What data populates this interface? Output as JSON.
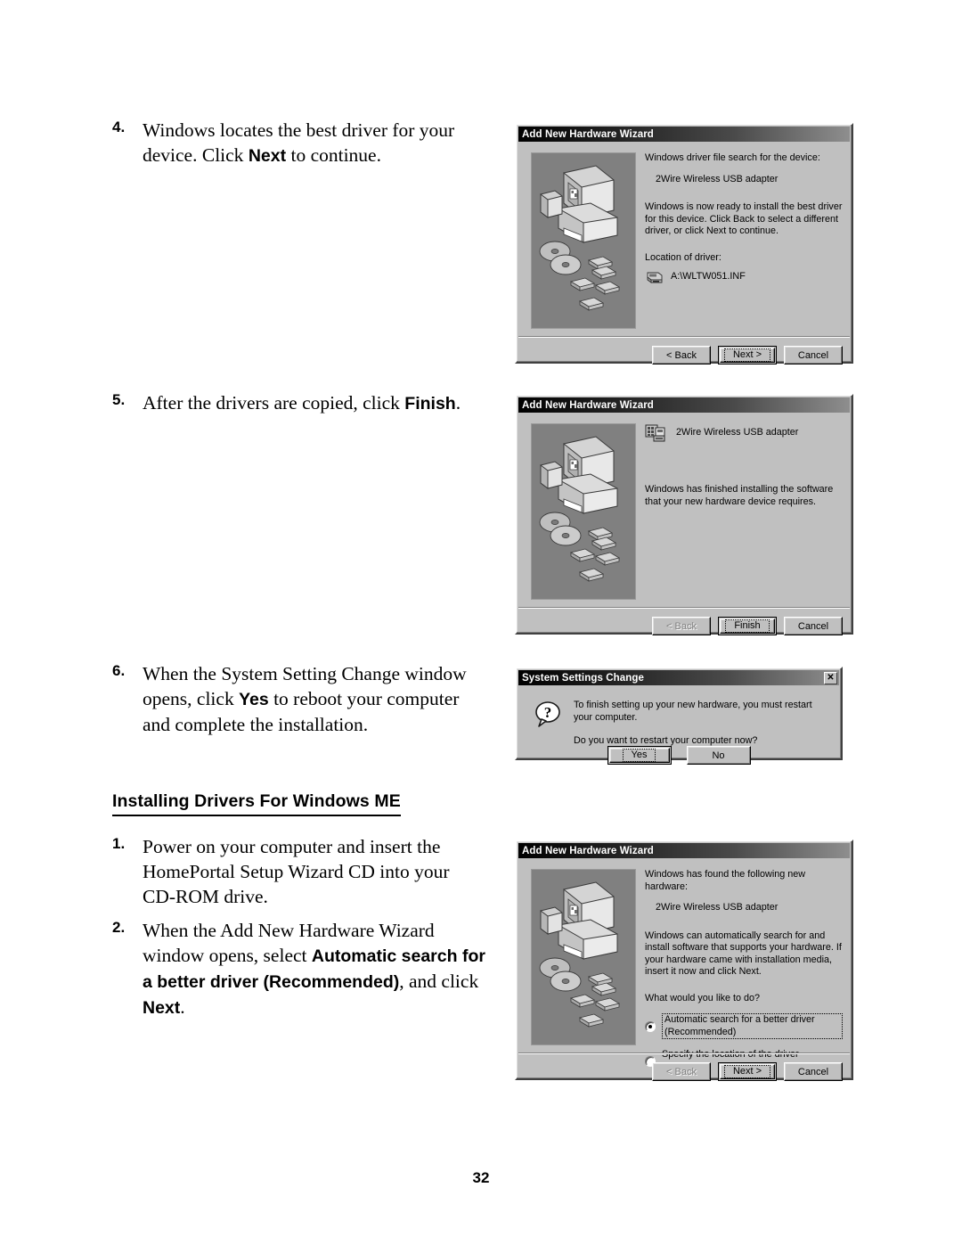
{
  "page": {
    "number": "32",
    "section_heading": "Installing Drivers For Windows ME"
  },
  "steps": [
    {
      "number": "4.",
      "text_parts": [
        {
          "t": "Windows locates the best driver for your device. Click ",
          "bold": false
        },
        {
          "t": "Next",
          "bold": true
        },
        {
          "t": " to continue.",
          "bold": false
        }
      ]
    },
    {
      "number": "5.",
      "text_parts": [
        {
          "t": "After the drivers are copied, click ",
          "bold": false
        },
        {
          "t": "Finish",
          "bold": true
        },
        {
          "t": ".",
          "bold": false
        }
      ]
    },
    {
      "number": "6.",
      "text_parts": [
        {
          "t": "When the System Setting Change window opens, click ",
          "bold": false
        },
        {
          "t": "Yes",
          "bold": true
        },
        {
          "t": " to reboot your computer and complete the installation.",
          "bold": false
        }
      ]
    },
    {
      "number": "1.",
      "text_parts": [
        {
          "t": "Power on your computer and insert the HomePortal Setup Wizard CD into your CD-ROM drive.",
          "bold": false
        }
      ]
    },
    {
      "number": "2.",
      "text_parts": [
        {
          "t": "When the Add New Hardware Wizard window opens, select ",
          "bold": false
        },
        {
          "t": "Automatic search for a better driver (Recommended)",
          "bold": true
        },
        {
          "t": ", and click ",
          "bold": false
        },
        {
          "t": "Next",
          "bold": true
        },
        {
          "t": ".",
          "bold": false
        }
      ]
    }
  ],
  "dialog_driver_found": {
    "title": "Add New Hardware Wizard",
    "line1": "Windows driver file search for the device:",
    "device_name": "2Wire Wireless USB adapter",
    "line2": "Windows is now ready to install the best driver for this device. Click Back to select a different driver, or click Next to continue.",
    "location_label": "Location of driver:",
    "driver_path": "A:\\WLTW051.INF",
    "buttons": {
      "back": "< Back",
      "next": "Next >",
      "cancel": "Cancel"
    }
  },
  "dialog_finish": {
    "title": "Add New Hardware Wizard",
    "device_name": "2Wire Wireless USB adapter",
    "message": "Windows has finished installing the software that your new hardware device requires.",
    "buttons": {
      "back": "< Back",
      "finish": "Finish",
      "cancel": "Cancel"
    }
  },
  "dialog_system_settings": {
    "title": "System Settings Change",
    "close_glyph": "✕",
    "line1": "To finish setting up your new hardware, you must restart your computer.",
    "line2": "Do you want to restart your computer now?",
    "buttons": {
      "yes": "Yes",
      "no": "No"
    }
  },
  "dialog_new_hardware": {
    "title": "Add New Hardware Wizard",
    "line1": "Windows has found the following new hardware:",
    "device_name": "2Wire Wireless USB adapter",
    "line2": "Windows can automatically search for and install software that supports your hardware. If your hardware came with installation media, insert it now and click Next.",
    "question": "What would you like to do?",
    "options": [
      {
        "label": "Automatic search for a better driver (Recommended)",
        "selected": true
      },
      {
        "label": "Specify the location of the driver (Advanced)",
        "selected": false
      }
    ],
    "buttons": {
      "back": "< Back",
      "next": "Next >",
      "cancel": "Cancel"
    }
  },
  "colors": {
    "dialog_face": "#c0c0c0",
    "titlebar_dark": "#000000",
    "art_background": "#808080",
    "text": "#000000"
  }
}
